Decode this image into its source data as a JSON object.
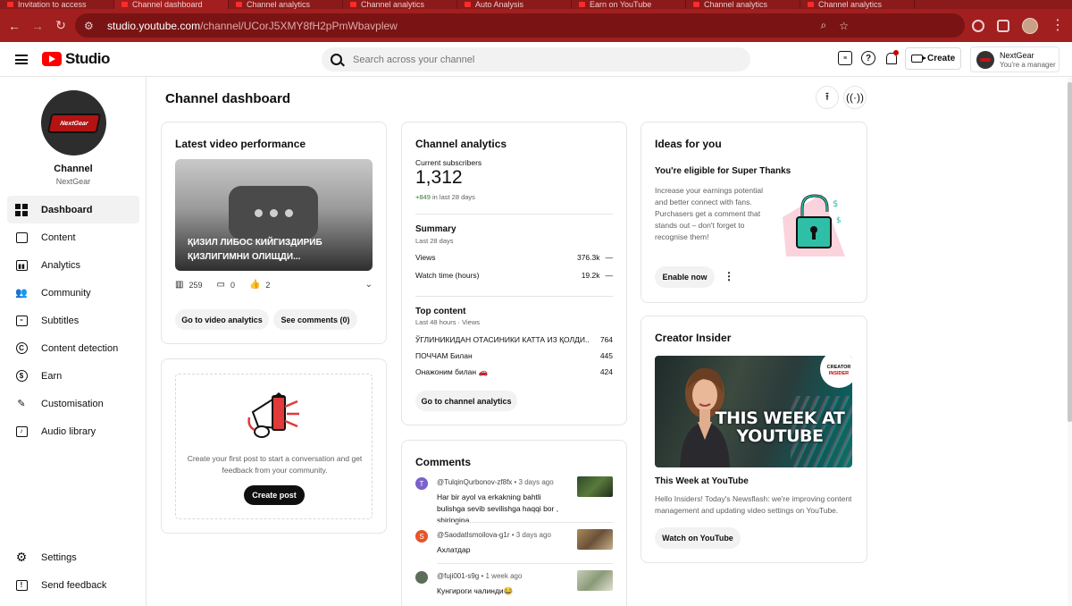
{
  "browser": {
    "tabs": [
      "Invitation to access",
      "Channel dashboard",
      "Channel analytics",
      "Channel analytics",
      "Auto Analysis",
      "Earn on YouTube",
      "Channel analytics",
      "Channel analytics"
    ],
    "url_host": "studio.youtube.com",
    "url_path": "/channel/UCorJ5XMY8fH2pPmWbavplew"
  },
  "topbar": {
    "studio_label": "Studio",
    "search_placeholder": "Search across your channel",
    "create_label": "Create",
    "account_name": "NextGear",
    "account_role": "You're a manager"
  },
  "sidebar": {
    "channel_title": "Channel",
    "channel_name": "NextGear",
    "avatar_text": "NextGear",
    "items": [
      {
        "label": "Dashboard",
        "icon": "dashboard-icon",
        "active": true
      },
      {
        "label": "Content",
        "icon": "content-icon"
      },
      {
        "label": "Analytics",
        "icon": "analytics-icon"
      },
      {
        "label": "Community",
        "icon": "community-icon"
      },
      {
        "label": "Subtitles",
        "icon": "subtitles-icon"
      },
      {
        "label": "Content detection",
        "icon": "copyright-icon"
      },
      {
        "label": "Earn",
        "icon": "earn-icon"
      },
      {
        "label": "Customisation",
        "icon": "customisation-icon"
      },
      {
        "label": "Audio library",
        "icon": "audio-library-icon"
      }
    ],
    "bottom": [
      {
        "label": "Settings",
        "icon": "gear-icon"
      },
      {
        "label": "Send feedback",
        "icon": "feedback-icon"
      }
    ]
  },
  "dashboard": {
    "title": "Channel dashboard",
    "latest_video": {
      "title": "Latest video performance",
      "video_title": "ҚИЗИЛ ЛИБОС КИЙГИЗДИРИБ ҚИЗЛИГИМНИ ОЛИЩДИ...",
      "views": "259",
      "comments": "0",
      "likes": "2",
      "btn_analytics": "Go to video analytics",
      "btn_comments": "See comments (0)"
    },
    "post": {
      "text": "Create your first post to start a conversation and get feedback from your community.",
      "button": "Create post"
    },
    "analytics": {
      "title": "Channel analytics",
      "subs_label": "Current subscribers",
      "subs_value": "1,312",
      "subs_delta": "+849",
      "subs_delta_period": " in last 28 days",
      "summary_title": "Summary",
      "summary_period": "Last 28 days",
      "rows": [
        {
          "label": "Views",
          "value": "376.3k",
          "trend": "—"
        },
        {
          "label": "Watch time (hours)",
          "value": "19.2k",
          "trend": "—"
        }
      ],
      "top_title": "Top content",
      "top_period": "Last 48 hours · Views",
      "top_items": [
        {
          "label": "ЎГЛИНИКИДАН ОТАСИНИКИ КАТТА ИЗ ҚОЛДИ...а",
          "value": "764"
        },
        {
          "label": "ПОЧЧАМ Билан",
          "value": "445"
        },
        {
          "label": "Онажоним билан 🚗",
          "value": "424"
        }
      ],
      "button": "Go to channel analytics"
    },
    "comments": {
      "title": "Comments",
      "items": [
        {
          "initial": "T",
          "color": "#7b61c9",
          "author": "@TulqinQurbonov-zf8fx",
          "time": " • 3 days ago",
          "text": "Har bir ayol va erkakning bahtli bulishga sevib sevilishga haqqi bor , shiringina ...",
          "thumb_color": "#3a5a3a"
        },
        {
          "initial": "S",
          "color": "#e8542a",
          "author": "@SaodatIsmoilova-g1r",
          "time": " • 3 days ago",
          "text": "Ахлатдар",
          "thumb_color": "#8a6a48"
        },
        {
          "initial": "",
          "color": "#5d6e5a",
          "author": "@fuji001-s9g",
          "time": " • 1 week ago",
          "text": "Кунгироги чалинди😂",
          "thumb_color": "#9aa08a"
        }
      ]
    },
    "ideas": {
      "title": "Ideas for you",
      "heading": "You're eligible for Super Thanks",
      "text": "Increase your earnings potential and better connect with fans. Purchasers get a comment that stands out – don't forget to recognise them!",
      "button": "Enable now"
    },
    "creator_insider": {
      "title": "Creator Insider",
      "thumb_text": "THIS WEEK AT YOUTUBE",
      "badge_top": "CREATOR",
      "badge_bottom": "INSIDER",
      "video_title": "This Week at YouTube",
      "text": "Hello Insiders! Today's Newsflash: we're improving content management and updating video settings on YouTube.",
      "button": "Watch on YouTube"
    }
  },
  "colors": {
    "accent": "#ff0000",
    "browser_chrome": "#a11f1f",
    "positive": "#2e7d32"
  }
}
